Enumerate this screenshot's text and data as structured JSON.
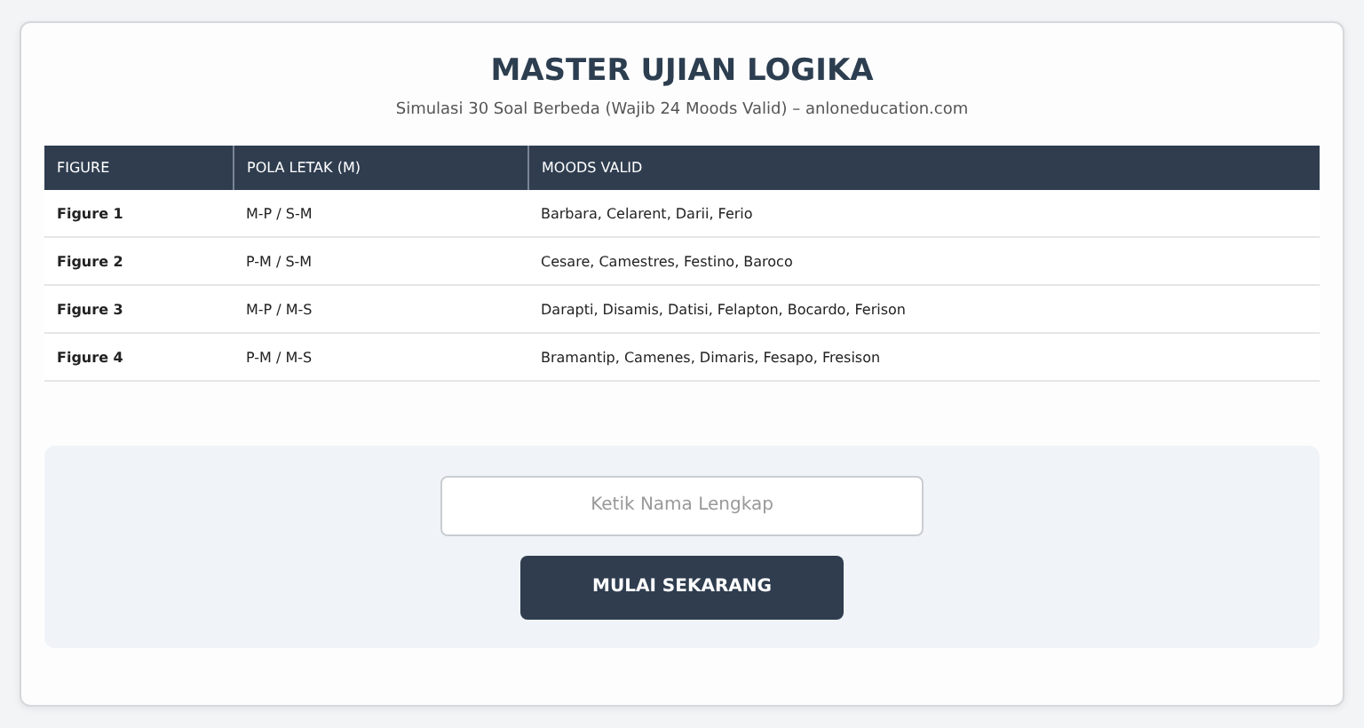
{
  "title": "MASTER UJIAN LOGIKA",
  "subtitle": "Simulasi 30 Soal Berbeda (Wajib 24 Moods Valid) – anloneducation.com",
  "table": {
    "columns": [
      "FIGURE",
      "POLA LETAK (M)",
      "MOODS VALID"
    ],
    "rows": [
      {
        "figure": "Figure 1",
        "pattern": "M-P / S-M",
        "moods": "Barbara, Celarent, Darii, Ferio"
      },
      {
        "figure": "Figure 2",
        "pattern": "P-M / S-M",
        "moods": "Cesare, Camestres, Festino, Baroco"
      },
      {
        "figure": "Figure 3",
        "pattern": "M-P / M-S",
        "moods": "Darapti, Disamis, Datisi, Felapton, Bocardo, Ferison"
      },
      {
        "figure": "Figure 4",
        "pattern": "P-M / M-S",
        "moods": "Bramantip, Camenes, Dimaris, Fesapo, Fresison"
      }
    ]
  },
  "name_field": {
    "placeholder": "Ketik Nama Lengkap"
  },
  "start_button": "MULAI SEKARANG"
}
